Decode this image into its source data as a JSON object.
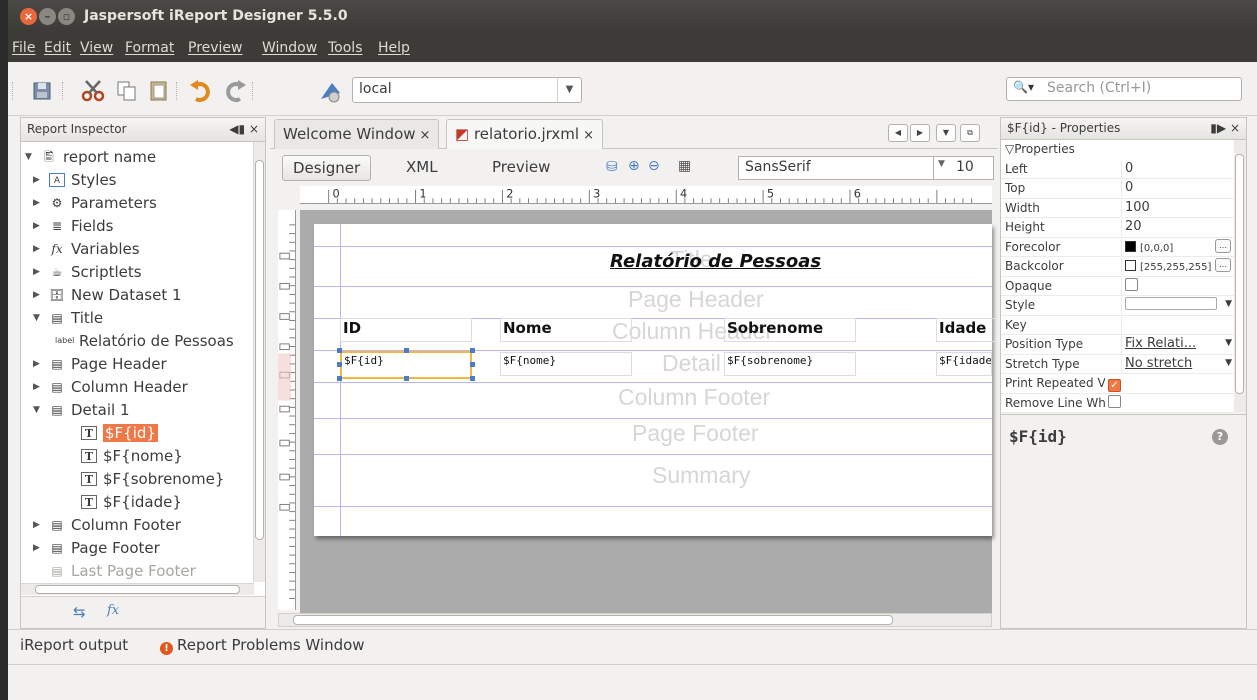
{
  "window": {
    "title": "Jaspersoft iReport Designer 5.5.0"
  },
  "menu": [
    "File",
    "Edit",
    "View",
    "Format",
    "Preview",
    "Window",
    "Tools",
    "Help"
  ],
  "toolbar": {
    "connection": "local",
    "search_placeholder": "Search (Ctrl+I)"
  },
  "inspector": {
    "title": "Report Inspector",
    "items": [
      {
        "label": "report name"
      },
      {
        "label": "Styles"
      },
      {
        "label": "Parameters"
      },
      {
        "label": "Fields"
      },
      {
        "label": "Variables"
      },
      {
        "label": "Scriptlets"
      },
      {
        "label": "New Dataset 1"
      },
      {
        "label": "Title"
      },
      {
        "label": "Relatório de Pessoas",
        "icon": "label"
      },
      {
        "label": "Page Header"
      },
      {
        "label": "Column Header"
      },
      {
        "label": "Detail 1"
      },
      {
        "label": "$F{id}"
      },
      {
        "label": "$F{nome}"
      },
      {
        "label": "$F{sobrenome}"
      },
      {
        "label": "$F{idade}"
      },
      {
        "label": "Column Footer"
      },
      {
        "label": "Page Footer"
      },
      {
        "label": "Last Page Footer"
      }
    ]
  },
  "editor": {
    "tabs": [
      {
        "label": "Welcome Window"
      },
      {
        "label": "relatorio.jrxml"
      }
    ],
    "views": [
      "Designer",
      "XML",
      "Preview"
    ],
    "font": "SansSerif",
    "size": "10",
    "ruler_numbers": [
      "0",
      "1",
      "2",
      "3",
      "4",
      "5",
      "6"
    ]
  },
  "report": {
    "title": "Relatório de Pessoas",
    "bands": [
      "Title",
      "Page Header",
      "Column Header",
      "Detail",
      "Column Footer",
      "Page Footer",
      "Summary"
    ],
    "headers": [
      "ID",
      "Nome",
      "Sobrenome",
      "Idade"
    ],
    "fields": [
      "$F{id}",
      "$F{nome}",
      "$F{sobrenome}",
      "$F{idade}"
    ]
  },
  "properties": {
    "title": "$F{id} - Properties",
    "section": "Properties",
    "rows": [
      {
        "key": "Left",
        "value": "0"
      },
      {
        "key": "Top",
        "value": "0"
      },
      {
        "key": "Width",
        "value": "100"
      },
      {
        "key": "Height",
        "value": "20"
      },
      {
        "key": "Forecolor",
        "value": "[0,0,0]"
      },
      {
        "key": "Backcolor",
        "value": "[255,255,255]"
      },
      {
        "key": "Opaque",
        "value": ""
      },
      {
        "key": "Style",
        "value": ""
      },
      {
        "key": "Key",
        "value": ""
      },
      {
        "key": "Position Type",
        "value": "Fix Relati..."
      },
      {
        "key": "Stretch Type",
        "value": "No stretch"
      },
      {
        "key": "Print Repeated Va",
        "value": ""
      },
      {
        "key": "Remove Line Whe",
        "value": ""
      }
    ],
    "description_title": "$F{id}"
  },
  "bottom": {
    "output": "iReport output",
    "problems": "Report Problems Window"
  },
  "colors": {
    "selection": "#f07746",
    "titlebar": "#3c3b37",
    "band_line": "#b9b6f0"
  }
}
